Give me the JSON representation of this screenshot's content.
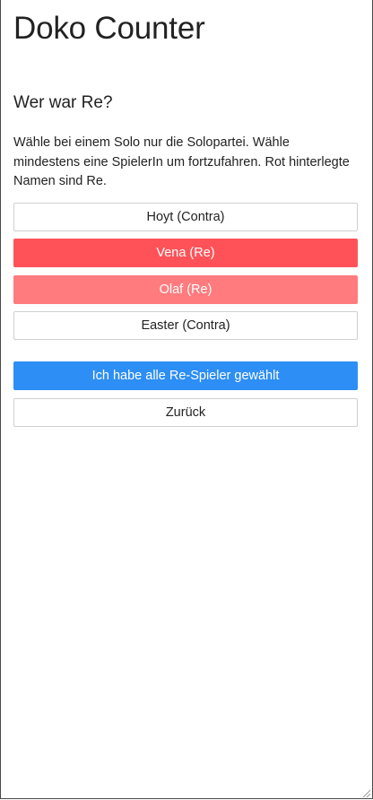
{
  "app": {
    "title": "Doko Counter"
  },
  "screen": {
    "question": "Wer war Re?",
    "instructions": "Wähle bei einem Solo nur die Solopartei. Wähle mindestens eine SpielerIn um fortzufahren. Rot hinterlegte Namen sind Re."
  },
  "players": [
    {
      "label": "Hoyt (Contra)",
      "party": "Contra"
    },
    {
      "label": "Vena (Re)",
      "party": "Re"
    },
    {
      "label": "Olaf (Re)",
      "party": "Re"
    },
    {
      "label": "Easter (Contra)",
      "party": "Contra"
    }
  ],
  "actions": {
    "confirm_label": "Ich habe alle Re-Spieler gewählt",
    "back_label": "Zurück"
  },
  "colors": {
    "re_primary": "#ff5258",
    "re_secondary": "#ff7b7d",
    "primary_action": "#2d8ef5",
    "border": "#d0d0d0"
  },
  "icons": {
    "window_corner": "resize-grip-icon"
  }
}
